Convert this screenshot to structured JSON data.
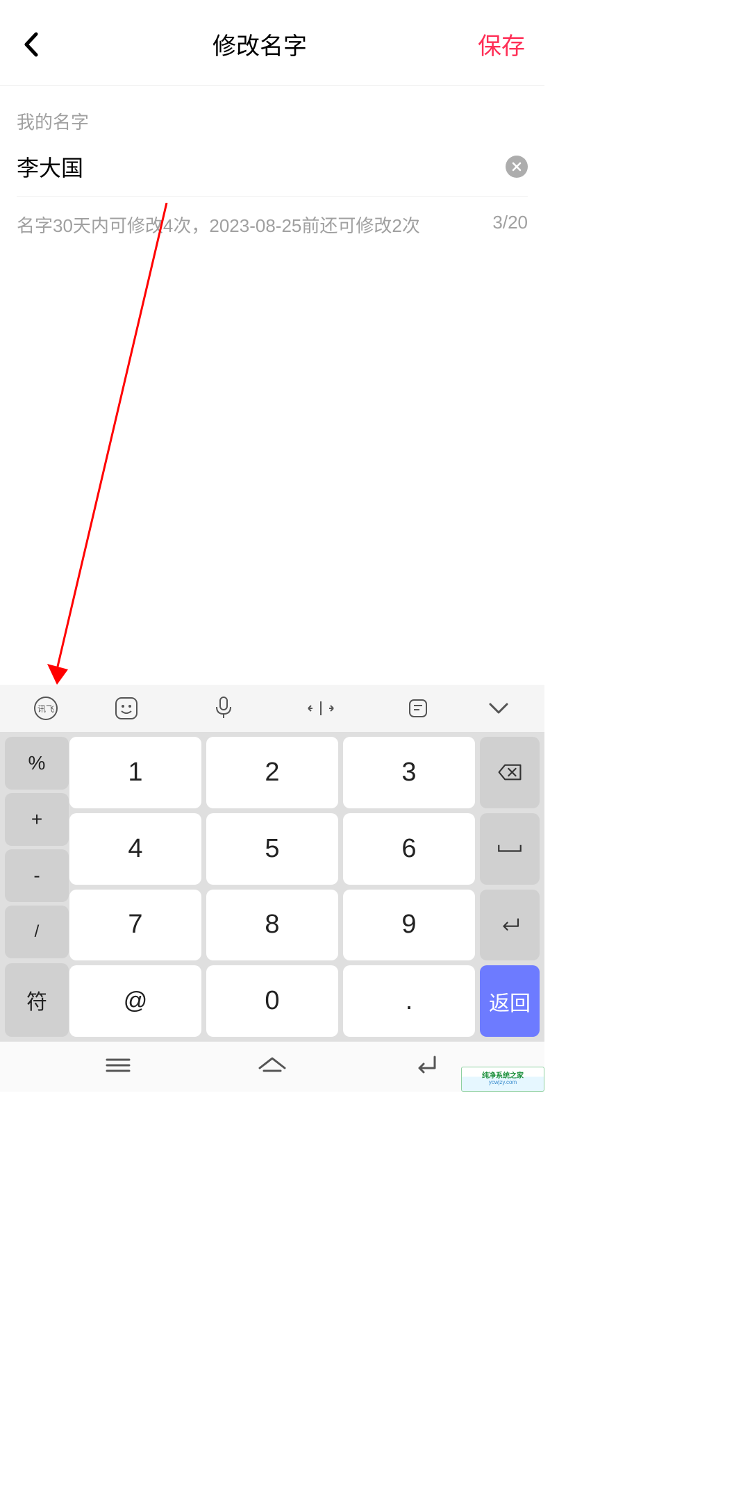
{
  "header": {
    "title": "修改名字",
    "save_label": "保存"
  },
  "form": {
    "field_label": "我的名字",
    "name_value": "李大国",
    "hint_text": "名字30天内可修改4次，2023-08-25前还可修改2次",
    "char_count": "3/20"
  },
  "keyboard": {
    "side_left": [
      "%",
      "+",
      "-",
      "/"
    ],
    "digits": [
      "1",
      "2",
      "3",
      "4",
      "5",
      "6",
      "7",
      "8",
      "9",
      "0"
    ],
    "symbol_key": "符",
    "at_key": "@",
    "dot_key": ".",
    "return_key": "返回"
  },
  "watermark": {
    "text": "纯净系统之家",
    "url": "ycwjzy.com"
  }
}
